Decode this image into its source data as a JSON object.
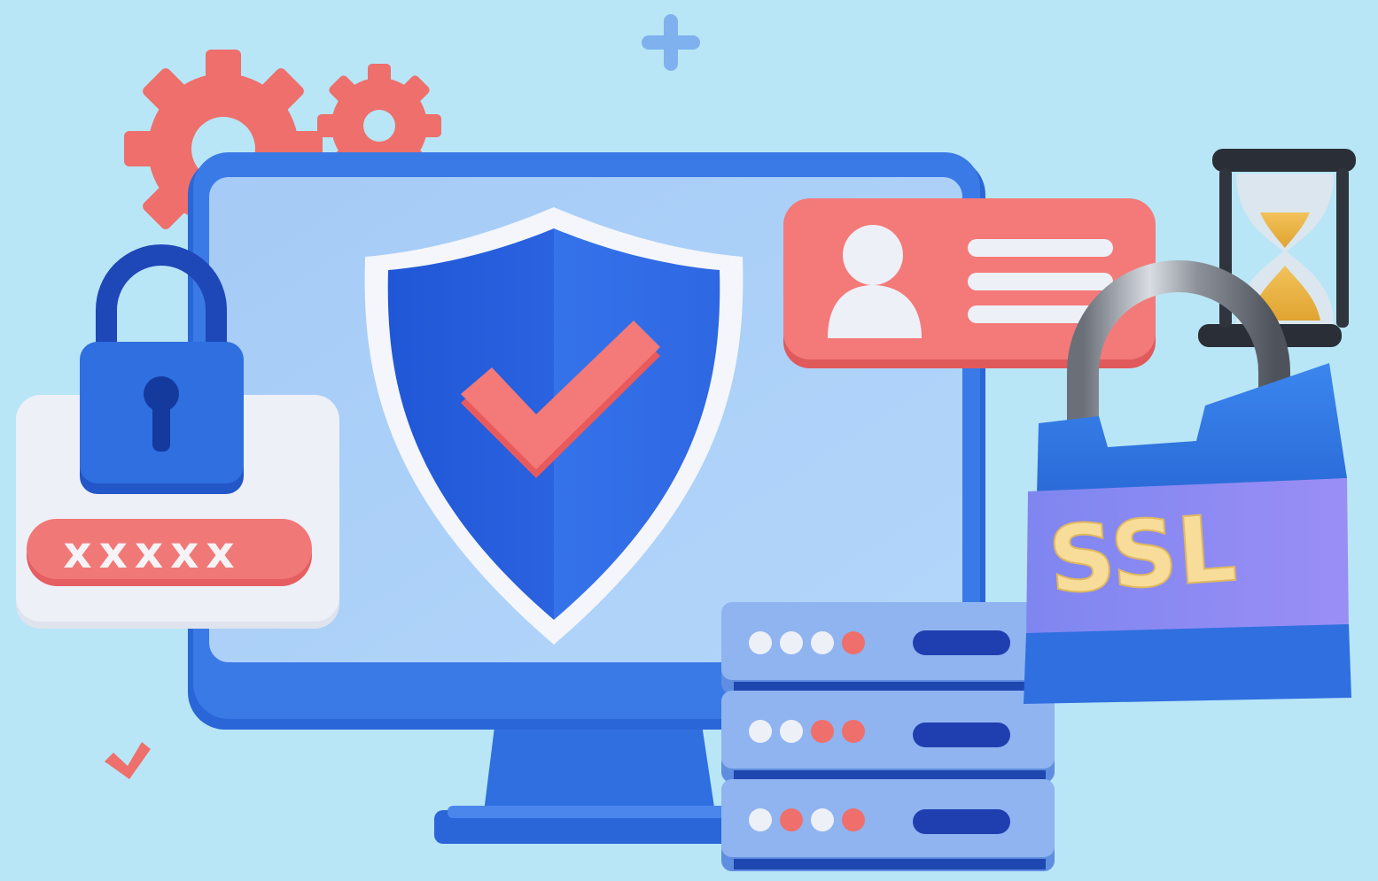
{
  "badge": {
    "text": "SSL"
  },
  "password_field": {
    "masked_value": "xxxxx"
  },
  "colors": {
    "background": "#b8e6f6",
    "monitor_frame": "#2f6fe0",
    "monitor_screen": "#a9cdf7",
    "shield": "#2d64dd",
    "accent_red": "#ef6b6b",
    "badge_band": "#8a86f2",
    "badge_text": "#f8dc9a",
    "server": "#8fb4f0"
  },
  "icons": [
    "plus-icon",
    "gear-icon",
    "monitor-icon",
    "shield-check-icon",
    "padlock-icon",
    "password-field",
    "user-id-card-icon",
    "hourglass-icon",
    "ssl-padlock-icon",
    "server-rack-icon",
    "checkmark-icon"
  ]
}
